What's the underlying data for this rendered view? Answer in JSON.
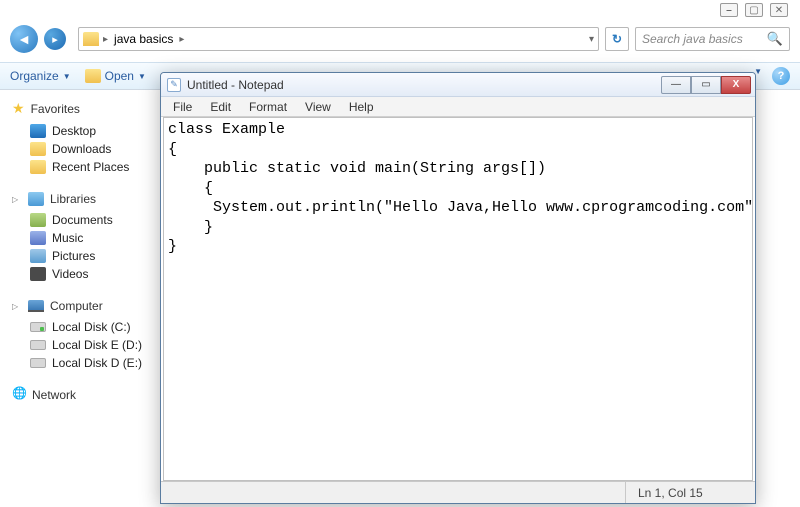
{
  "window_controls": {
    "min": "⎯",
    "max": "▢",
    "close": "✕"
  },
  "breadcrumb": {
    "crumb1": "java basics",
    "sep": "▸",
    "dropdown": "▾"
  },
  "search": {
    "placeholder": "Search java basics"
  },
  "toolbar": {
    "organize": "Organize",
    "open": "Open",
    "drop": "▼"
  },
  "sidebar": {
    "favorites": {
      "label": "Favorites",
      "items": [
        "Desktop",
        "Downloads",
        "Recent Places"
      ]
    },
    "libraries": {
      "label": "Libraries",
      "items": [
        "Documents",
        "Music",
        "Pictures",
        "Videos"
      ]
    },
    "computer": {
      "label": "Computer",
      "items": [
        "Local Disk (C:)",
        "Local Disk E (D:)",
        "Local Disk D (E:)"
      ]
    },
    "network": {
      "label": "Network"
    }
  },
  "notepad": {
    "title": "Untitled - Notepad",
    "menu": [
      "File",
      "Edit",
      "Format",
      "View",
      "Help"
    ],
    "content": "class Example \n{\n    public static void main(String args[])\n    {\n     System.out.println(\"Hello Java,Hello www.cprogramcoding.com\");\n    }\n}",
    "status": "Ln 1, Col 15",
    "btns": {
      "min": "—",
      "max": "▭",
      "close": "X"
    }
  }
}
